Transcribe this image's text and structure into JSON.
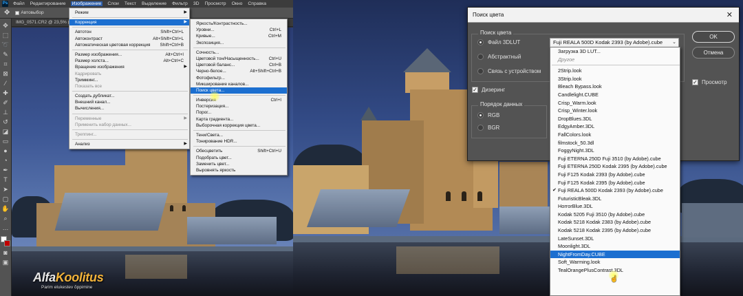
{
  "menubar": {
    "items": [
      "Файл",
      "Редактирование",
      "Изображение",
      "Слои",
      "Текст",
      "Выделение",
      "Фильтр",
      "3D",
      "Просмотр",
      "Окно",
      "Справка"
    ],
    "active_index": 2
  },
  "optbar": {
    "autoselect_label": "Автовыбор"
  },
  "doc_tab": {
    "title": "IMG_0571.CR2 @ 23,5% ("
  },
  "image_menu": {
    "items": [
      {
        "label": "Режим",
        "shortcut": "",
        "submenu": true,
        "disabled": false,
        "selected": false,
        "sep_after": true
      },
      {
        "label": "Коррекция",
        "shortcut": "",
        "submenu": true,
        "disabled": false,
        "selected": true,
        "sep_after": true
      },
      {
        "label": "Автотон",
        "shortcut": "Shift+Ctrl+L",
        "submenu": false,
        "disabled": false,
        "selected": false,
        "sep_after": false
      },
      {
        "label": "Автоконтраст",
        "shortcut": "Alt+Shift+Ctrl+L",
        "submenu": false,
        "disabled": false,
        "selected": false,
        "sep_after": false
      },
      {
        "label": "Автоматическая цветовая коррекция",
        "shortcut": "Shift+Ctrl+B",
        "submenu": false,
        "disabled": false,
        "selected": false,
        "sep_after": true
      },
      {
        "label": "Размер изображения...",
        "shortcut": "Alt+Ctrl+I",
        "submenu": false,
        "disabled": false,
        "selected": false,
        "sep_after": false
      },
      {
        "label": "Размер холста...",
        "shortcut": "Alt+Ctrl+C",
        "submenu": false,
        "disabled": false,
        "selected": false,
        "sep_after": false
      },
      {
        "label": "Вращение изображения",
        "shortcut": "",
        "submenu": true,
        "disabled": false,
        "selected": false,
        "sep_after": false
      },
      {
        "label": "Кадрировать",
        "shortcut": "",
        "submenu": false,
        "disabled": true,
        "selected": false,
        "sep_after": false
      },
      {
        "label": "Тримминг...",
        "shortcut": "",
        "submenu": false,
        "disabled": false,
        "selected": false,
        "sep_after": false
      },
      {
        "label": "Показать все",
        "shortcut": "",
        "submenu": false,
        "disabled": true,
        "selected": false,
        "sep_after": true
      },
      {
        "label": "Создать дубликат...",
        "shortcut": "",
        "submenu": false,
        "disabled": false,
        "selected": false,
        "sep_after": false
      },
      {
        "label": "Внешний канал...",
        "shortcut": "",
        "submenu": false,
        "disabled": false,
        "selected": false,
        "sep_after": false
      },
      {
        "label": "Вычисления...",
        "shortcut": "",
        "submenu": false,
        "disabled": false,
        "selected": false,
        "sep_after": true
      },
      {
        "label": "Переменные",
        "shortcut": "",
        "submenu": true,
        "disabled": true,
        "selected": false,
        "sep_after": false
      },
      {
        "label": "Применить набор данных...",
        "shortcut": "",
        "submenu": false,
        "disabled": true,
        "selected": false,
        "sep_after": true
      },
      {
        "label": "Треппинг...",
        "shortcut": "",
        "submenu": false,
        "disabled": true,
        "selected": false,
        "sep_after": true
      },
      {
        "label": "Анализ",
        "shortcut": "",
        "submenu": true,
        "disabled": false,
        "selected": false,
        "sep_after": false
      }
    ]
  },
  "adjust_menu": {
    "items": [
      {
        "label": "Яркость/Контрастность...",
        "shortcut": "",
        "selected": false,
        "sep_after": false
      },
      {
        "label": "Уровни...",
        "shortcut": "Ctrl+L",
        "selected": false,
        "sep_after": false
      },
      {
        "label": "Кривые...",
        "shortcut": "Ctrl+M",
        "selected": false,
        "sep_after": false
      },
      {
        "label": "Экспозиция...",
        "shortcut": "",
        "selected": false,
        "sep_after": true
      },
      {
        "label": "Сочность...",
        "shortcut": "",
        "selected": false,
        "sep_after": false
      },
      {
        "label": "Цветовой тон/Насыщенность...",
        "shortcut": "Ctrl+U",
        "selected": false,
        "sep_after": false
      },
      {
        "label": "Цветовой баланс...",
        "shortcut": "Ctrl+B",
        "selected": false,
        "sep_after": false
      },
      {
        "label": "Черно-белое...",
        "shortcut": "Alt+Shift+Ctrl+B",
        "selected": false,
        "sep_after": false
      },
      {
        "label": "Фотофильтр...",
        "shortcut": "",
        "selected": false,
        "sep_after": false
      },
      {
        "label": "Микширование каналов...",
        "shortcut": "",
        "selected": false,
        "sep_after": false
      },
      {
        "label": "Поиск цвета...",
        "shortcut": "",
        "selected": true,
        "sep_after": true
      },
      {
        "label": "Инверсия",
        "shortcut": "Ctrl+I",
        "selected": false,
        "sep_after": false
      },
      {
        "label": "Постеризация...",
        "shortcut": "",
        "selected": false,
        "sep_after": false
      },
      {
        "label": "Порог...",
        "shortcut": "",
        "selected": false,
        "sep_after": false
      },
      {
        "label": "Карта градиента...",
        "shortcut": "",
        "selected": false,
        "sep_after": false
      },
      {
        "label": "Выборочная коррекция цвета...",
        "shortcut": "",
        "selected": false,
        "sep_after": true
      },
      {
        "label": "Тени/Света...",
        "shortcut": "",
        "selected": false,
        "sep_after": false
      },
      {
        "label": "Тонирование HDR...",
        "shortcut": "",
        "selected": false,
        "sep_after": true
      },
      {
        "label": "Обесцветить",
        "shortcut": "Shift+Ctrl+U",
        "selected": false,
        "sep_after": false
      },
      {
        "label": "Подобрать цвет...",
        "shortcut": "",
        "selected": false,
        "sep_after": false
      },
      {
        "label": "Заменить цвет...",
        "shortcut": "",
        "selected": false,
        "sep_after": false
      },
      {
        "label": "Выровнять яркость",
        "shortcut": "",
        "selected": false,
        "sep_after": false
      }
    ]
  },
  "watermark": {
    "brand_a": "Alfa",
    "brand_b": "Koolitus",
    "tagline": "Parim elukestev õppimine"
  },
  "dialog": {
    "title": "Поиск цвета",
    "group_lookup": "Поиск цвета",
    "radio_3dlut": "Файл 3DLUT",
    "radio_abstract": "Абстрактный",
    "radio_device": "Связь с устройством",
    "lut_selected": "Fuji REALA 500D Kodak 2393 (by Adobe).cube",
    "dither_label": "Дизеринг",
    "group_order": "Порядок данных",
    "radio_rgb": "RGB",
    "radio_bgr": "BGR",
    "ok_label": "OK",
    "cancel_label": "Отмена",
    "preview_label": "Просмотр"
  },
  "lut_list": {
    "items": [
      {
        "label": "Загрузка 3D LUT...",
        "disabled": false,
        "checked": false,
        "selected": false,
        "sep_after": false
      },
      {
        "label": "Другое",
        "disabled": true,
        "checked": false,
        "selected": false,
        "sep_after": true
      },
      {
        "label": "2Strip.look",
        "disabled": false,
        "checked": false,
        "selected": false,
        "sep_after": false
      },
      {
        "label": "3Strip.look",
        "disabled": false,
        "checked": false,
        "selected": false,
        "sep_after": false
      },
      {
        "label": "Bleach Bypass.look",
        "disabled": false,
        "checked": false,
        "selected": false,
        "sep_after": false
      },
      {
        "label": "Candlelight.CUBE",
        "disabled": false,
        "checked": false,
        "selected": false,
        "sep_after": false
      },
      {
        "label": "Crisp_Warm.look",
        "disabled": false,
        "checked": false,
        "selected": false,
        "sep_after": false
      },
      {
        "label": "Crisp_Winter.look",
        "disabled": false,
        "checked": false,
        "selected": false,
        "sep_after": false
      },
      {
        "label": "DropBlues.3DL",
        "disabled": false,
        "checked": false,
        "selected": false,
        "sep_after": false
      },
      {
        "label": "EdgyAmber.3DL",
        "disabled": false,
        "checked": false,
        "selected": false,
        "sep_after": false
      },
      {
        "label": "FallColors.look",
        "disabled": false,
        "checked": false,
        "selected": false,
        "sep_after": false
      },
      {
        "label": "filmstock_50.3dl",
        "disabled": false,
        "checked": false,
        "selected": false,
        "sep_after": false
      },
      {
        "label": "FoggyNight.3DL",
        "disabled": false,
        "checked": false,
        "selected": false,
        "sep_after": false
      },
      {
        "label": "Fuji ETERNA 250D Fuji 3510 (by Adobe).cube",
        "disabled": false,
        "checked": false,
        "selected": false,
        "sep_after": false
      },
      {
        "label": "Fuji ETERNA 250D Kodak 2395 (by Adobe).cube",
        "disabled": false,
        "checked": false,
        "selected": false,
        "sep_after": false
      },
      {
        "label": "Fuji F125 Kodak 2393 (by Adobe).cube",
        "disabled": false,
        "checked": false,
        "selected": false,
        "sep_after": false
      },
      {
        "label": "Fuji F125 Kodak 2395 (by Adobe).cube",
        "disabled": false,
        "checked": false,
        "selected": false,
        "sep_after": false
      },
      {
        "label": "Fuji REALA 500D Kodak 2393 (by Adobe).cube",
        "disabled": false,
        "checked": true,
        "selected": false,
        "sep_after": false
      },
      {
        "label": "FuturisticBleak.3DL",
        "disabled": false,
        "checked": false,
        "selected": false,
        "sep_after": false
      },
      {
        "label": "HorrorBlue.3DL",
        "disabled": false,
        "checked": false,
        "selected": false,
        "sep_after": false
      },
      {
        "label": "Kodak 5205 Fuji 3510 (by Adobe).cube",
        "disabled": false,
        "checked": false,
        "selected": false,
        "sep_after": false
      },
      {
        "label": "Kodak 5218 Kodak 2383 (by Adobe).cube",
        "disabled": false,
        "checked": false,
        "selected": false,
        "sep_after": false
      },
      {
        "label": "Kodak 5218 Kodak 2395 (by Adobe).cube",
        "disabled": false,
        "checked": false,
        "selected": false,
        "sep_after": false
      },
      {
        "label": "LateSunset.3DL",
        "disabled": false,
        "checked": false,
        "selected": false,
        "sep_after": false
      },
      {
        "label": "Moonlight.3DL",
        "disabled": false,
        "checked": false,
        "selected": false,
        "sep_after": false
      },
      {
        "label": "NightFromDay.CUBE",
        "disabled": false,
        "checked": false,
        "selected": true,
        "sep_after": false
      },
      {
        "label": "Soft_Warming.look",
        "disabled": false,
        "checked": false,
        "selected": false,
        "sep_after": false
      },
      {
        "label": "TealOrangePlusContrast.3DL",
        "disabled": false,
        "checked": false,
        "selected": false,
        "sep_after": false
      }
    ]
  },
  "colors": {
    "menu_highlight": "#1c6fd0",
    "ps_dark": "#323232",
    "dialog_bg": "#535353"
  }
}
